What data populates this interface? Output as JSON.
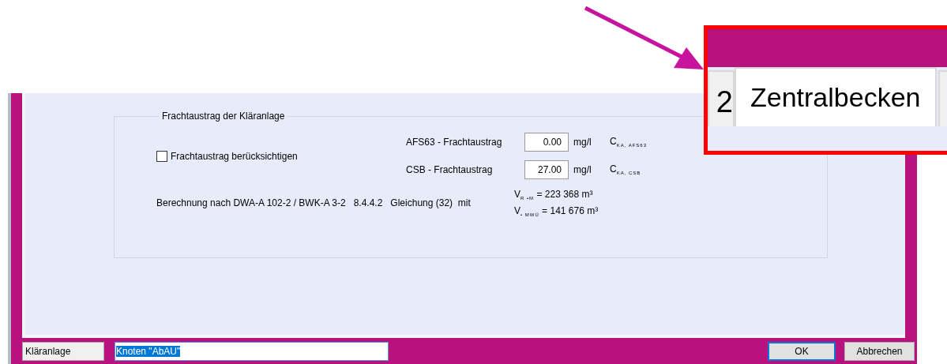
{
  "dialog": {
    "group_title": "Frachtaustrag der Kläranlage",
    "checkbox": {
      "label": "Frachtaustrag berücksichtigen",
      "checked": false
    },
    "loads": [
      {
        "label": "AFS63 - Frachtaustrag",
        "value": "0.00",
        "unit": "mg/l",
        "symbol": "C$_{KA, AFS63}$"
      },
      {
        "label": "CSB - Frachtaustrag",
        "value": "27.00",
        "unit": "mg/l",
        "symbol": "C$_{KA, CSB}$"
      }
    ],
    "method": "Berechnung nach DWA-A 102-2 / BWK-A 3-2   8.4.4.2   Gleichung (32)  mit",
    "volumes": [
      "V$_{R •M}$ = 223 368 m³",
      "V$_{• MWÜ}$ = 141 676 m³"
    ]
  },
  "status_bar": {
    "name_field": "Kläranlage",
    "node_field": {
      "value": "Knoten \"AbAU\"",
      "selected": true
    },
    "buttons": [
      {
        "label": "OK",
        "default": true
      },
      {
        "label": "Abbrechen",
        "default": false
      }
    ]
  },
  "callout": {
    "tabs": [
      {
        "label": "2",
        "selected": false
      },
      {
        "label": "Zentralbecken",
        "selected": true
      }
    ]
  }
}
